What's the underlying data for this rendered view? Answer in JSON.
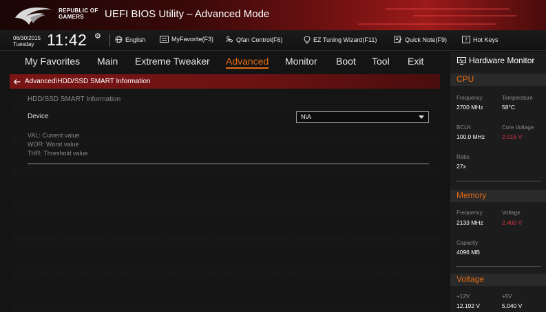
{
  "header": {
    "brand_line1": "REPUBLIC OF",
    "brand_line2": "GAMERS",
    "title": "UEFI BIOS Utility – Advanced Mode"
  },
  "infobar": {
    "date": "06/30/2015",
    "day": "Tuesday",
    "time": "11:42",
    "language": "English",
    "myfavorite": "MyFavorite(F3)",
    "qfan": "Qfan Control(F6)",
    "ez_tuning": "EZ Tuning Wizard(F11)",
    "quick_note": "Quick Note(F9)",
    "hot_keys": "Hot Keys"
  },
  "menu": {
    "items": [
      "My Favorites",
      "Main",
      "Extreme Tweaker",
      "Advanced",
      "Monitor",
      "Boot",
      "Tool",
      "Exit"
    ],
    "active": "Advanced"
  },
  "breadcrumb": "Advanced\\HDD/SSD SMART Information",
  "content": {
    "section_title": "HDD/SSD SMART Information",
    "device_label": "Device",
    "device_value": "N\\A",
    "legend": [
      "VAL:  Current value",
      "WOR:  Worst value",
      "THR:  Threshold value"
    ]
  },
  "hw_monitor": {
    "title": "Hardware Monitor",
    "cpu": {
      "heading": "CPU",
      "frequency_label": "Frequency",
      "frequency": "2700 MHz",
      "temperature_label": "Temperature",
      "temperature": "58°C",
      "bclk_label": "BCLK",
      "bclk": "100.0 MHz",
      "core_voltage_label": "Core Voltage",
      "core_voltage": "2.016 V",
      "ratio_label": "Ratio",
      "ratio": "27x"
    },
    "memory": {
      "heading": "Memory",
      "frequency_label": "Frequency",
      "frequency": "2133 MHz",
      "voltage_label": "Voltage",
      "voltage": "2.400 V",
      "capacity_label": "Capacity",
      "capacity": "4096 MB"
    },
    "voltage": {
      "heading": "Voltage",
      "v12_label": "+12V",
      "v12": "12.192 V",
      "v5_label": "+5V",
      "v5": "5.040 V"
    }
  },
  "colors": {
    "accent": "#e36b12",
    "alert": "#d9363e",
    "crumb_bg": "#7a1515"
  }
}
